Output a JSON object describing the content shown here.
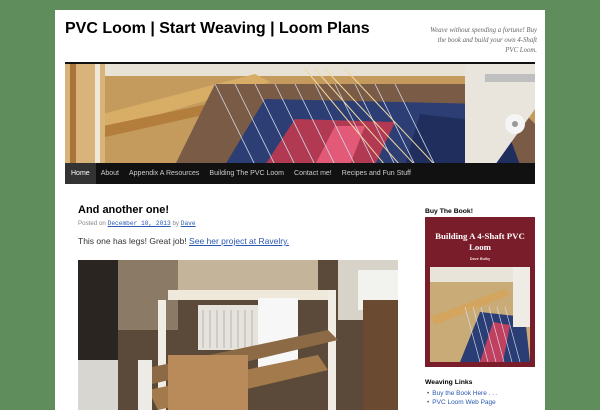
{
  "site": {
    "title": "PVC Loom | Start Weaving | Loom Plans",
    "description": "Weave without spending a fortune! Buy the book and build your own 4-Shaft PVC Loom."
  },
  "nav": {
    "items": [
      {
        "label": "Home",
        "active": true
      },
      {
        "label": "About"
      },
      {
        "label": "Appendix A Resources"
      },
      {
        "label": "Building The PVC Loom"
      },
      {
        "label": "Contact me!"
      },
      {
        "label": "Recipes and Fun Stuff"
      }
    ]
  },
  "post": {
    "title": "And another one!",
    "meta_prefix": "Posted on",
    "date": "December 10, 2013",
    "by": "by",
    "author": "Dave",
    "body_text": "This one has legs!  Great job!",
    "body_link": "See her project at Ravelry."
  },
  "sidebar": {
    "book_heading": "Buy The Book!",
    "book_title": "Building A 4-Shaft PVC Loom",
    "book_author": "Dave Bulky",
    "links_heading": "Weaving Links",
    "links": [
      "Buy the Book Here . . .",
      "PVC Loom Web Page"
    ]
  },
  "colors": {
    "background": "#5f8d5c",
    "nav_bg": "#111111",
    "link": "#2b58b0",
    "book_cover": "#7a1d2a"
  }
}
